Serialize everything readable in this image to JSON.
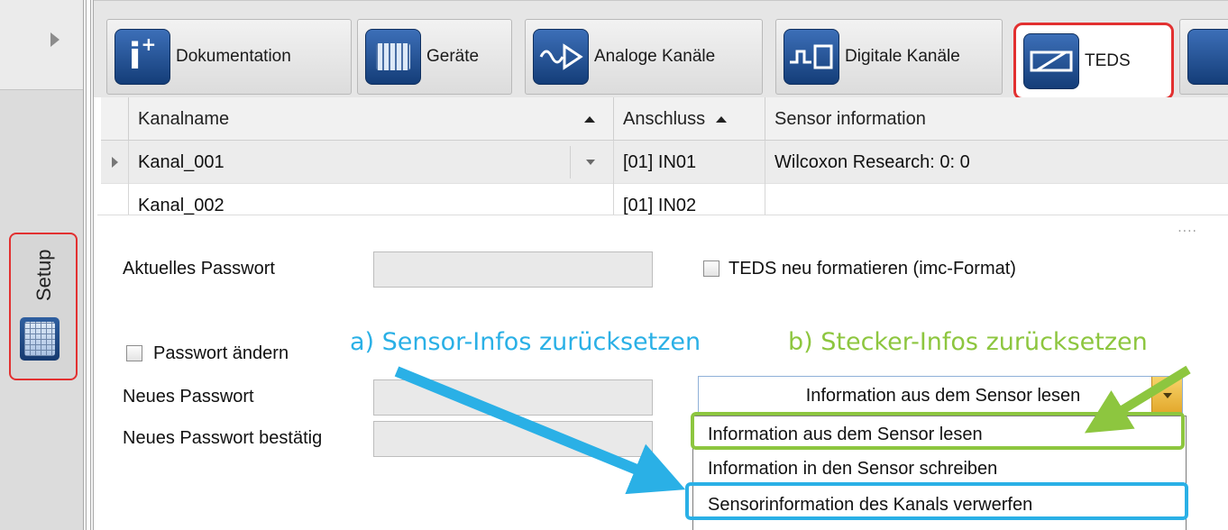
{
  "sidebar": {
    "setup_label": "Setup",
    "expand_icon": "triangle-right-icon",
    "setup_icon": "keyboard-icon"
  },
  "tabs": [
    {
      "label": "Dokumentation",
      "icon": "info-plus-icon"
    },
    {
      "label": "Geräte",
      "icon": "device-icon"
    },
    {
      "label": "Analoge Kanäle",
      "icon": "analog-signal-icon"
    },
    {
      "label": "Digitale Kanäle",
      "icon": "digital-signal-icon"
    },
    {
      "label": "TEDS",
      "icon": "sensor-teds-icon",
      "active": true
    }
  ],
  "grid": {
    "columns": [
      "Kanalname",
      "Anschluss",
      "Sensor information"
    ],
    "rows": [
      {
        "name": "Kanal_001",
        "port": "[01] IN01",
        "sensor": "Wilcoxon Research: 0: 0"
      },
      {
        "name": "Kanal_002",
        "port": "[01] IN02",
        "sensor": ""
      }
    ]
  },
  "form": {
    "current_password_label": "Aktuelles Passwort",
    "teds_format_label": "TEDS neu formatieren (imc-Format)",
    "change_password_label": "Passwort ändern",
    "new_password_label": "Neues Passwort",
    "confirm_password_label": "Neues Passwort bestätig"
  },
  "action_select": {
    "value": "Information aus dem Sensor lesen",
    "options": [
      "Information aus dem Sensor lesen",
      "Information in den Sensor schreiben",
      "Sensorinformation des Kanals verwerfen"
    ]
  },
  "annotations": {
    "a": "a) Sensor-Infos zurücksetzen",
    "b": "b) Stecker-Infos zurücksetzen",
    "color_a": "#2ab0e6",
    "color_b": "#8dc63f",
    "highlight_red": "#e23030"
  }
}
